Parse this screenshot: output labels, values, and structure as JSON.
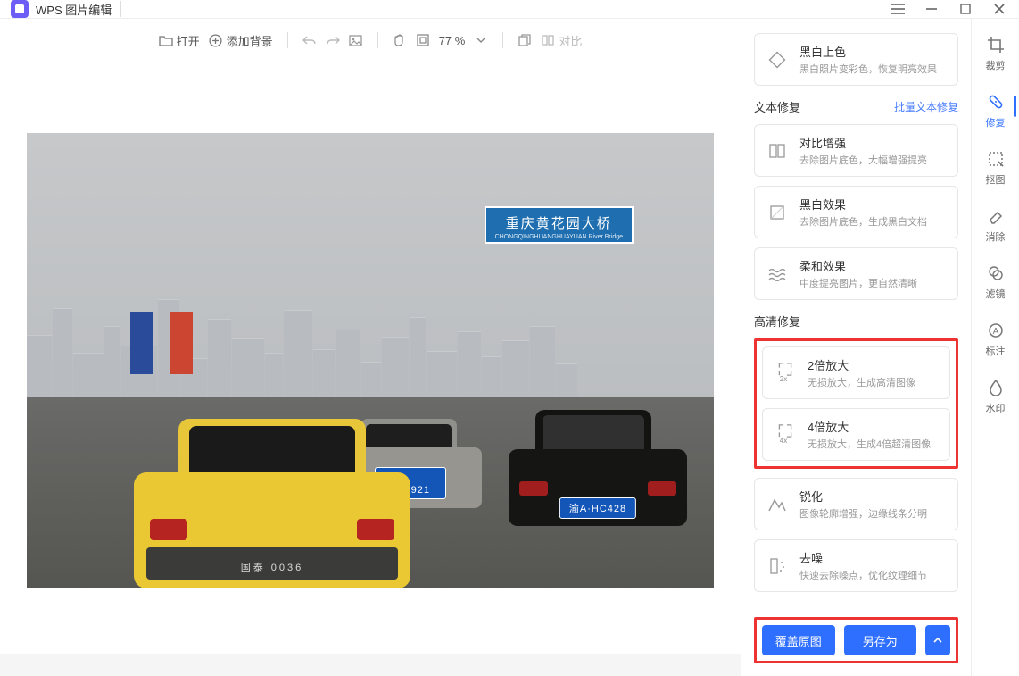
{
  "app": {
    "title": "WPS 图片编辑"
  },
  "toolbar": {
    "open": "打开",
    "add_bg": "添加背景",
    "zoom": "77 %",
    "compare": "对比"
  },
  "image_scene": {
    "sign_main": "重庆黄花园大桥",
    "sign_sub": "CHONGQINGHUANGHUAYUAN River Bridge",
    "plate_taxi": "渝B·EX921",
    "plate_right": "渝A·HC428",
    "taxi_bumper_text": "国泰 0036"
  },
  "panel": {
    "bw_color": {
      "title": "黑白上色",
      "desc": "黑白照片变彩色，恢复明亮效果"
    },
    "text_repair": {
      "heading": "文本修复",
      "link": "批量文本修复"
    },
    "contrast": {
      "title": "对比增强",
      "desc": "去除图片底色，大幅增强提亮"
    },
    "bw_effect": {
      "title": "黑白效果",
      "desc": "去除图片底色，生成黑白文档"
    },
    "soft_effect": {
      "title": "柔和效果",
      "desc": "中度提亮图片，更自然清晰"
    },
    "hd_repair": {
      "heading": "高清修复"
    },
    "upscale2": {
      "title": "2倍放大",
      "desc": "无损放大，生成高清图像",
      "badge": "2x"
    },
    "upscale4": {
      "title": "4倍放大",
      "desc": "无损放大，生成4倍超清图像",
      "badge": "4x"
    },
    "sharpen": {
      "title": "锐化",
      "desc": "图像轮廓增强，边缘线条分明"
    },
    "denoise": {
      "title": "去噪",
      "desc": "快速去除噪点，优化纹理细节"
    },
    "overwrite": "覆盖原图",
    "saveas": "另存为"
  },
  "sidebar": {
    "crop": "裁剪",
    "repair": "修复",
    "cutout": "抠图",
    "erase": "消除",
    "filter": "滤镜",
    "annotate": "标注",
    "watermark": "水印"
  }
}
